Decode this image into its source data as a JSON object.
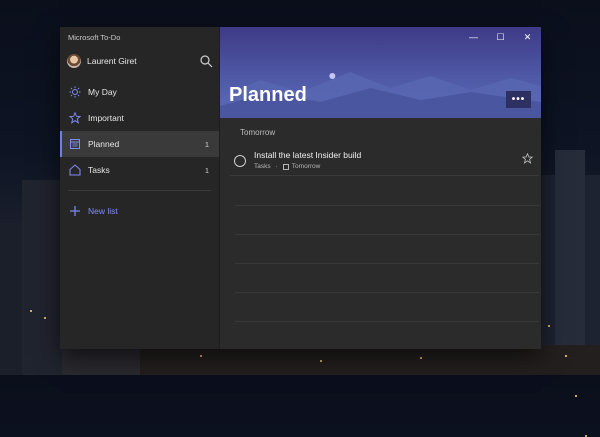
{
  "app": {
    "title": "Microsoft To-Do"
  },
  "user": {
    "name": "Laurent Giret"
  },
  "sidebar": {
    "items": [
      {
        "label": "My Day",
        "count": "",
        "icon": "sun-icon"
      },
      {
        "label": "Important",
        "count": "",
        "icon": "star-icon"
      },
      {
        "label": "Planned",
        "count": "1",
        "icon": "calendar-icon",
        "active": true
      },
      {
        "label": "Tasks",
        "count": "1",
        "icon": "home-icon"
      }
    ],
    "new_list_label": "New list"
  },
  "main": {
    "title": "Planned",
    "more_label": "•••",
    "group_label": "Tomorrow",
    "tasks": [
      {
        "title": "Install the latest Insider build",
        "list": "Tasks",
        "separator": "·",
        "due": "Tomorrow"
      }
    ]
  },
  "window_controls": {
    "minimize": "—",
    "maximize": "☐",
    "close": "✕"
  },
  "colors": {
    "accent": "#6c7ef0",
    "sidebar_bg": "#262626",
    "main_bg": "#2b2b2b",
    "banner": "#4f59a6"
  }
}
